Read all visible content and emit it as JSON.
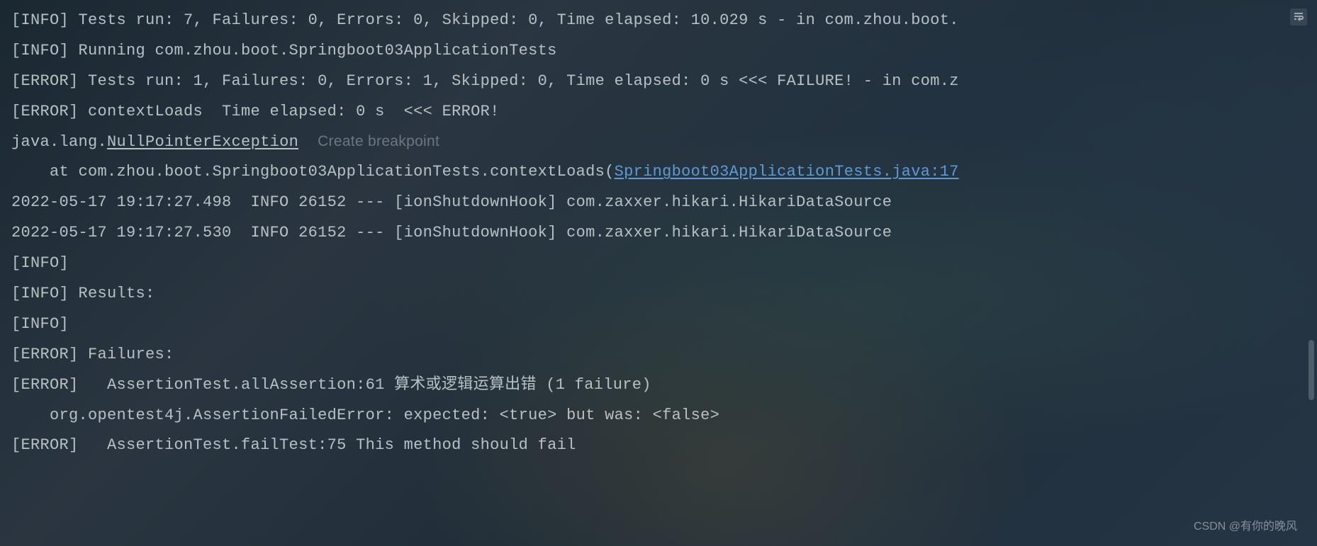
{
  "console": {
    "lines": [
      {
        "segments": [
          {
            "text": "[INFO] Tests run: 7, Failures: 0, Errors: 0, Skipped: 0, Time elapsed: 10.029 s - in com.zhou.boot.",
            "style": "plain"
          }
        ]
      },
      {
        "segments": [
          {
            "text": "[INFO] Running com.zhou.boot.Springboot03ApplicationTests",
            "style": "plain"
          }
        ]
      },
      {
        "segments": [
          {
            "text": "[ERROR] Tests run: 1, Failures: 0, Errors: 1, Skipped: 0, Time elapsed: 0 s <<< FAILURE! - in com.z",
            "style": "plain"
          }
        ]
      },
      {
        "segments": [
          {
            "text": "[ERROR] contextLoads  Time elapsed: 0 s  <<< ERROR!",
            "style": "plain"
          }
        ]
      },
      {
        "segments": [
          {
            "text": "java.lang.",
            "style": "plain"
          },
          {
            "text": "NullPointerException",
            "style": "underline"
          },
          {
            "text": "  ",
            "style": "plain"
          },
          {
            "text": "Create breakpoint",
            "style": "hint"
          }
        ]
      },
      {
        "segments": [
          {
            "text": "    at com.zhou.boot.Springboot03ApplicationTests.contextLoads(",
            "style": "plain"
          },
          {
            "text": "Springboot03ApplicationTests.java:17",
            "style": "link"
          }
        ]
      },
      {
        "segments": [
          {
            "text": "2022-05-17 19:17:27.498  INFO 26152 --- [ionShutdownHook] com.zaxxer.hikari.HikariDataSource",
            "style": "plain"
          }
        ]
      },
      {
        "segments": [
          {
            "text": "2022-05-17 19:17:27.530  INFO 26152 --- [ionShutdownHook] com.zaxxer.hikari.HikariDataSource",
            "style": "plain"
          }
        ]
      },
      {
        "segments": [
          {
            "text": "[INFO] ",
            "style": "plain"
          }
        ]
      },
      {
        "segments": [
          {
            "text": "[INFO] Results:",
            "style": "plain"
          }
        ]
      },
      {
        "segments": [
          {
            "text": "[INFO] ",
            "style": "plain"
          }
        ]
      },
      {
        "segments": [
          {
            "text": "[ERROR] Failures: ",
            "style": "plain"
          }
        ]
      },
      {
        "segments": [
          {
            "text": "[ERROR]   AssertionTest.allAssertion:61 算术或逻辑运算出错 (1 failure)",
            "style": "plain"
          }
        ]
      },
      {
        "segments": [
          {
            "text": "    org.opentest4j.AssertionFailedError: expected: <true> but was: <false>",
            "style": "plain"
          }
        ]
      },
      {
        "segments": [
          {
            "text": "[ERROR]   AssertionTest.failTest:75 This method should fail",
            "style": "plain"
          }
        ]
      }
    ]
  },
  "toolbar": {
    "soft_wrap_tooltip": "Soft-Wrap"
  },
  "watermark": "CSDN @有你的晚风"
}
